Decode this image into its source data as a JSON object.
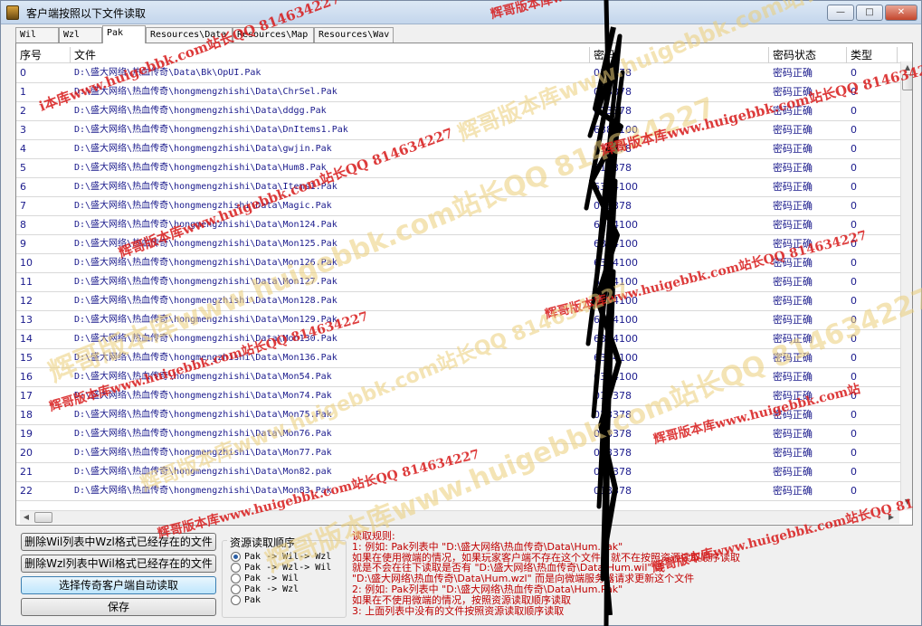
{
  "window": {
    "title": "客户端按照以下文件读取",
    "minimize_glyph": "—",
    "maximize_glyph": "□",
    "close_glyph": "✕"
  },
  "tabs": [
    {
      "label": "Wil",
      "active": false
    },
    {
      "label": "Wzl",
      "active": false
    },
    {
      "label": "Pak",
      "active": true
    },
    {
      "label": "Resources\\Data",
      "active": false
    },
    {
      "label": "Resources\\Map",
      "active": false
    },
    {
      "label": "Resources\\Wav",
      "active": false
    }
  ],
  "table": {
    "columns": [
      "序号",
      "文件",
      "密码",
      "密码状态",
      "类型"
    ],
    "rows": [
      {
        "idx": "0",
        "path": "D:\\盛大网络\\热血传奇\\Data\\Bk\\OpUI.Pak",
        "pwd": "013378",
        "status": "密码正确",
        "type": "0"
      },
      {
        "idx": "1",
        "path": "D:\\盛大网络\\热血传奇\\hongmengzhishi\\Data\\ChrSel.Pak",
        "pwd": "013378",
        "status": "密码正确",
        "type": "0"
      },
      {
        "idx": "2",
        "path": "D:\\盛大网络\\热血传奇\\hongmengzhishi\\Data\\ddgg.Pak",
        "pwd": "013378",
        "status": "密码正确",
        "type": "0"
      },
      {
        "idx": "3",
        "path": "D:\\盛大网络\\热血传奇\\hongmengzhishi\\Data\\DnItems1.Pak",
        "pwd": "6384100",
        "status": "密码正确",
        "type": "0"
      },
      {
        "idx": "4",
        "path": "D:\\盛大网络\\热血传奇\\hongmengzhishi\\Data\\gwjin.Pak",
        "pwd": "013378",
        "status": "密码正确",
        "type": "0"
      },
      {
        "idx": "5",
        "path": "D:\\盛大网络\\热血传奇\\hongmengzhishi\\Data\\Hum8.Pak",
        "pwd": "013378",
        "status": "密码正确",
        "type": "0"
      },
      {
        "idx": "6",
        "path": "D:\\盛大网络\\热血传奇\\hongmengzhishi\\Data\\Items1.Pak",
        "pwd": "6384100",
        "status": "密码正确",
        "type": "0"
      },
      {
        "idx": "7",
        "path": "D:\\盛大网络\\热血传奇\\hongmengzhishi\\Data\\Magic.Pak",
        "pwd": "013378",
        "status": "密码正确",
        "type": "0"
      },
      {
        "idx": "8",
        "path": "D:\\盛大网络\\热血传奇\\hongmengzhishi\\Data\\Mon124.Pak",
        "pwd": "6384100",
        "status": "密码正确",
        "type": "0"
      },
      {
        "idx": "9",
        "path": "D:\\盛大网络\\热血传奇\\hongmengzhishi\\Data\\Mon125.Pak",
        "pwd": "6384100",
        "status": "密码正确",
        "type": "0"
      },
      {
        "idx": "10",
        "path": "D:\\盛大网络\\热血传奇\\hongmengzhishi\\Data\\Mon126.Pak",
        "pwd": "6384100",
        "status": "密码正确",
        "type": "0"
      },
      {
        "idx": "11",
        "path": "D:\\盛大网络\\热血传奇\\hongmengzhishi\\Data\\Mon127.Pak",
        "pwd": "6384100",
        "status": "密码正确",
        "type": "0"
      },
      {
        "idx": "12",
        "path": "D:\\盛大网络\\热血传奇\\hongmengzhishi\\Data\\Mon128.Pak",
        "pwd": "6384100",
        "status": "密码正确",
        "type": "0"
      },
      {
        "idx": "13",
        "path": "D:\\盛大网络\\热血传奇\\hongmengzhishi\\Data\\Mon129.Pak",
        "pwd": "6384100",
        "status": "密码正确",
        "type": "0"
      },
      {
        "idx": "14",
        "path": "D:\\盛大网络\\热血传奇\\hongmengzhishi\\Data\\Mon130.Pak",
        "pwd": "6384100",
        "status": "密码正确",
        "type": "0"
      },
      {
        "idx": "15",
        "path": "D:\\盛大网络\\热血传奇\\hongmengzhishi\\Data\\Mon136.Pak",
        "pwd": "6384100",
        "status": "密码正确",
        "type": "0"
      },
      {
        "idx": "16",
        "path": "D:\\盛大网络\\热血传奇\\hongmengzhishi\\Data\\Mon54.Pak",
        "pwd": "6384100",
        "status": "密码正确",
        "type": "0"
      },
      {
        "idx": "17",
        "path": "D:\\盛大网络\\热血传奇\\hongmengzhishi\\Data\\Mon74.Pak",
        "pwd": "013378",
        "status": "密码正确",
        "type": "0"
      },
      {
        "idx": "18",
        "path": "D:\\盛大网络\\热血传奇\\hongmengzhishi\\Data\\Mon75.Pak",
        "pwd": "013378",
        "status": "密码正确",
        "type": "0"
      },
      {
        "idx": "19",
        "path": "D:\\盛大网络\\热血传奇\\hongmengzhishi\\Data\\Mon76.Pak",
        "pwd": "013378",
        "status": "密码正确",
        "type": "0"
      },
      {
        "idx": "20",
        "path": "D:\\盛大网络\\热血传奇\\hongmengzhishi\\Data\\Mon77.Pak",
        "pwd": "013378",
        "status": "密码正确",
        "type": "0"
      },
      {
        "idx": "21",
        "path": "D:\\盛大网络\\热血传奇\\hongmengzhishi\\Data\\Mon82.pak",
        "pwd": "013378",
        "status": "密码正确",
        "type": "0"
      },
      {
        "idx": "22",
        "path": "D:\\盛大网络\\热血传奇\\hongmengzhishi\\Data\\Mon83.Pak",
        "pwd": "013378",
        "status": "密码正确",
        "type": "0"
      }
    ]
  },
  "buttons": {
    "delete_wil": "删除Wil列表中Wzl格式已经存在的文件",
    "delete_wzl": "删除Wzl列表中Wil格式已经存在的文件",
    "auto_read": "选择传奇客户端自动读取",
    "save": "保存"
  },
  "read_order": {
    "title": "资源读取顺序",
    "options": [
      {
        "label": "Pak -> Wil-> Wzl",
        "checked": true
      },
      {
        "label": "Pak -> Wzl-> Wil",
        "checked": false
      },
      {
        "label": "Pak -> Wil",
        "checked": false
      },
      {
        "label": "Pak -> Wzl",
        "checked": false
      },
      {
        "label": "Pak",
        "checked": false
      }
    ]
  },
  "rules": {
    "title": "读取规则:",
    "lines": [
      "1: 例如: Pak列表中 \"D:\\盛大网络\\热血传奇\\Data\\Hum.Pak\"",
      "   如果在使用微端的情况，如果玩家客户端不存在这个文件，就不在按照资源读取顺序读取",
      "   就是不会在往下读取是否有 \"D:\\盛大网络\\热血传奇\\Data\\Hum.wil\" 或",
      "   \"D:\\盛大网络\\热血传奇\\Data\\Hum.wzl\" 而是向微端服务器请求更新这个文件",
      "2: 例如: Pak列表中 \"D:\\盛大网络\\热血传奇\\Data\\Hum.Pak\"",
      "   如果在不使用微端的情况，按照资源读取顺序读取",
      "3: 上面列表中没有的文件按照资源读取顺序读取"
    ]
  },
  "watermarks": [
    "辉哥版本库www.huigebbk.com站长QQ 814634227",
    "辉哥版本库www.huigebbk.com站长QQ 814634227",
    "i本库www.huigebbk.com站长QQ 814634227",
    "辉哥版本库www.huigebbk.com站长QQ 814634227",
    "辉哥版本库www.huigebbk.com站长QQ 814634227",
    "辉哥版本库www.huigebbk.com站长QQ 814634227",
    "辉哥版本库www.huigebbk.com站长QQ 814634227",
    "辉哥版本库www.huigebbk.com站",
    "辉哥版本库www.huigebbk.com站长QQ 81",
    "辉哥版本库www.huigebbk.com站长QQ 814634227",
    "辉哥版本库www.huigebbk.com站长QQ 814634227",
    "辉哥版本库www.huigebbk.com站长QQ 814634227",
    "辉哥版本库www.huigebbk.com站长QQ 814634227"
  ],
  "colors": {
    "list_text": "#1a1a8c",
    "rules_text": "#c00000",
    "watermark": "#d71919"
  }
}
